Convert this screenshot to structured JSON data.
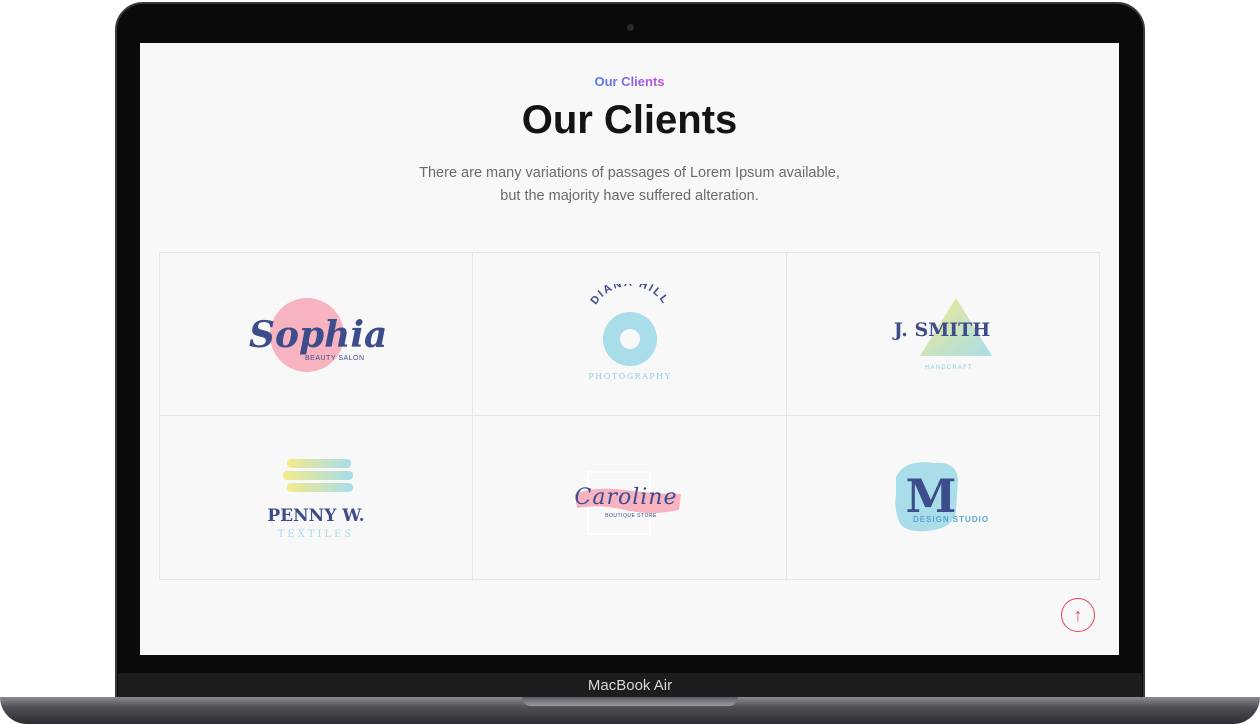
{
  "device": {
    "label": "MacBook Air"
  },
  "section": {
    "eyebrow": "Our Clients",
    "title": "Our Clients",
    "description_line1": "There are many variations of passages of Lorem Ipsum available,",
    "description_line2": "but the majority have suffered alteration."
  },
  "clients": [
    {
      "name": "Sophia",
      "tagline": "BEAUTY SALON"
    },
    {
      "name": "DIANA HILL",
      "tagline": "PHOTOGRAPHY"
    },
    {
      "name": "J. SMITH",
      "tagline": "HANDCRAFT"
    },
    {
      "name": "PENNY W.",
      "tagline": "TEXTILES"
    },
    {
      "name": "Caroline",
      "tagline": "BOUTIQUE STORE"
    },
    {
      "name": "M",
      "tagline": "DESIGN STUDIO"
    }
  ],
  "scroll_top": {
    "icon": "arrow-up-icon",
    "glyph": "↑"
  },
  "colors": {
    "accent": "#e8435a",
    "navy": "#3d4c8a",
    "pink": "#f7a8b8",
    "aqua": "#a8dde9",
    "yellow": "#f3ea8c"
  }
}
